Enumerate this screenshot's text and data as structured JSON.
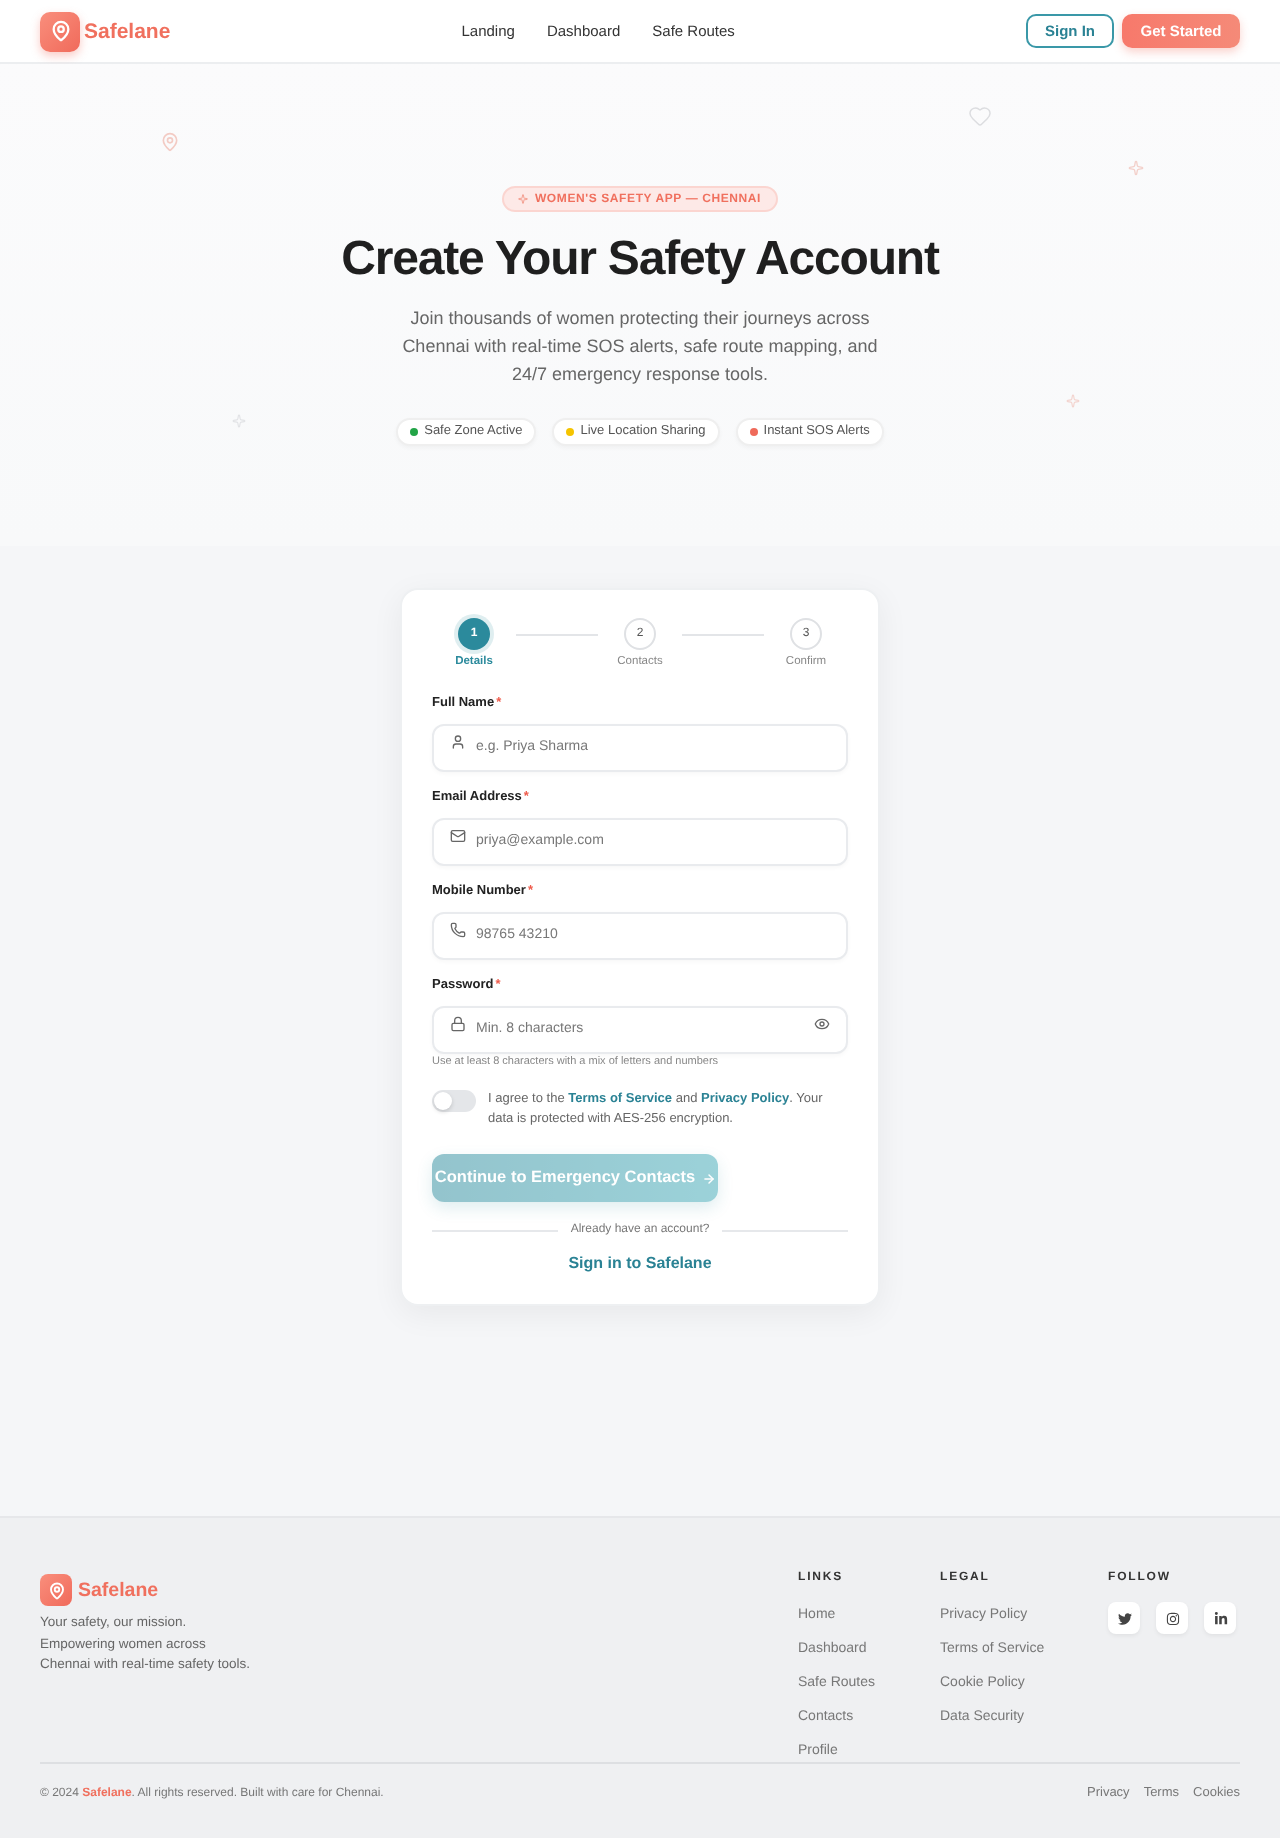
{
  "header": {
    "logo": "Safelane",
    "nav": [
      "Landing",
      "Dashboard",
      "Safe Routes"
    ],
    "sign_in": "Sign In",
    "get_started": "Get Started"
  },
  "hero": {
    "badge": "WOMEN'S SAFETY APP — CHENNAI",
    "title": "Create Your Safety Account",
    "subtitle": "Join thousands of women protecting their journeys across Chennai with real-time SOS alerts, safe route mapping, and 24/7 emergency response tools.",
    "features": [
      {
        "label": "Safe Zone Active",
        "color": "#22a447"
      },
      {
        "label": "Live Location Sharing",
        "color": "#f5c400"
      },
      {
        "label": "Instant SOS Alerts",
        "color": "#ef6a5a"
      }
    ]
  },
  "form": {
    "steps": [
      {
        "number": "1",
        "label": "Details",
        "selected": true
      },
      {
        "number": "2",
        "label": "Contacts",
        "selected": false
      },
      {
        "number": "3",
        "label": "Confirm",
        "selected": false
      }
    ],
    "fields": [
      {
        "kind": "name",
        "label": "Full Name",
        "required_mark": "*",
        "placeholder": "e.g. Priya Sharma"
      },
      {
        "kind": "email",
        "label": "Email Address",
        "required_mark": "*",
        "placeholder": "priya@example.com"
      },
      {
        "kind": "phone",
        "label": "Mobile Number",
        "required_mark": "*",
        "placeholder": "98765 43210"
      },
      {
        "kind": "password",
        "label": "Password",
        "required_mark": "*",
        "placeholder": "Min. 8 characters",
        "hint": "Use at least 8 characters with a mix of letters and numbers"
      }
    ],
    "consent": {
      "on": false,
      "text_start": "I agree to the",
      "terms_link": "Terms of Service",
      "joiner": "and",
      "privacy_link": "Privacy Policy",
      "text_end": ". Your data is protected with AES-256 encryption."
    },
    "submit": {
      "label": "Continue to Emergency Contacts",
      "disabled": true
    },
    "divider": "Already have an account?",
    "sign_in_link": "Sign in to Safelane"
  },
  "footer": {
    "logo": "Safelane",
    "tagline": "Your safety, our mission. Empowering women across Chennai with real-time safety tools.",
    "columns": [
      {
        "heading": "LINKS",
        "links": [
          "Home",
          "Dashboard",
          "Safe Routes",
          "Contacts",
          "Profile"
        ]
      },
      {
        "heading": "LEGAL",
        "links": [
          "Privacy Policy",
          "Terms of Service",
          "Cookie Policy",
          "Data Security"
        ]
      }
    ],
    "follow_heading": "FOLLOW",
    "copyright": {
      "start": "© 2024",
      "brand": "Safelane",
      "end": ". All rights reserved. Built with care for Chennai."
    },
    "bottom_links": [
      "Privacy",
      "Terms",
      "Cookies"
    ]
  }
}
